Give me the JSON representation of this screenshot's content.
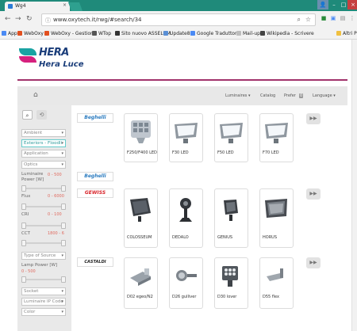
{
  "browser": {
    "tab_title": "Wg4",
    "tab_close": "×",
    "url": "www.oxytech.it/rwg/#search/34",
    "window_controls": {
      "minimize": "–",
      "maximize": "□",
      "close": "×"
    }
  },
  "bookmarks": [
    {
      "label": "App",
      "color": "#4a8af4"
    },
    {
      "label": "WebOxy",
      "color": "#e2501f"
    },
    {
      "label": "WebOxy - Gestione",
      "color": "#e2501f"
    },
    {
      "label": "WTop",
      "color": "#555555"
    },
    {
      "label": "Sito nuovo ASSELUM",
      "color": "#333333"
    },
    {
      "label": "Update8",
      "color": "#5a8fd5"
    },
    {
      "label": "Google Traduttore",
      "color": "#4a8af4"
    },
    {
      "label": "Mail-up",
      "color": "#bdbdbd"
    },
    {
      "label": "Wikipedia - Scrivere",
      "color": "#444444"
    },
    {
      "label": "Altri P",
      "color": "#f0c040"
    }
  ],
  "site": {
    "logo_top": "HERA",
    "logo_bottom": "Hera Luce",
    "nav": {
      "luminaires": "Luminaires ▾",
      "catalog": "Catalog",
      "prefer": "Prefer",
      "prefer_badge": "0",
      "language": "Language ▾"
    }
  },
  "filters": {
    "ambient": "Ambient",
    "exterior": "Exteriors - Floodli",
    "application": "Application",
    "optics": "Optics",
    "luminaire_power_label": "Luminaire Power [W]",
    "luminaire_power_range": "0 - 500",
    "flux_label": "Flux",
    "flux_range": "0 - 6000",
    "cri_label": "CRI",
    "cri_range": "0 - 100",
    "cct_label": "CCT",
    "cct_range": "1800 - 6",
    "type_of_source": "Type of Source",
    "lamp_power_label": "Lamp Power [W]",
    "lamp_power_range": "0 - 500",
    "socket": "Socket",
    "ip_code": "Luminaire IP Code",
    "color": "Color"
  },
  "brands": {
    "beghelli": "Beghelli",
    "gewiss": "GEWISS",
    "castaldi": "CASTALDI"
  },
  "products": {
    "row1": [
      "F250/F400 LED",
      "F30 LED",
      "F50 LED",
      "F70 LED"
    ],
    "row2": [
      "COLOSSEUM",
      "DEDALO",
      "GENIUS",
      "HORUS"
    ],
    "row3": [
      "D02 egeo/N2",
      "D26 gulliver",
      "D30 lover",
      "D55 flex"
    ]
  },
  "more_label": "▶▶"
}
